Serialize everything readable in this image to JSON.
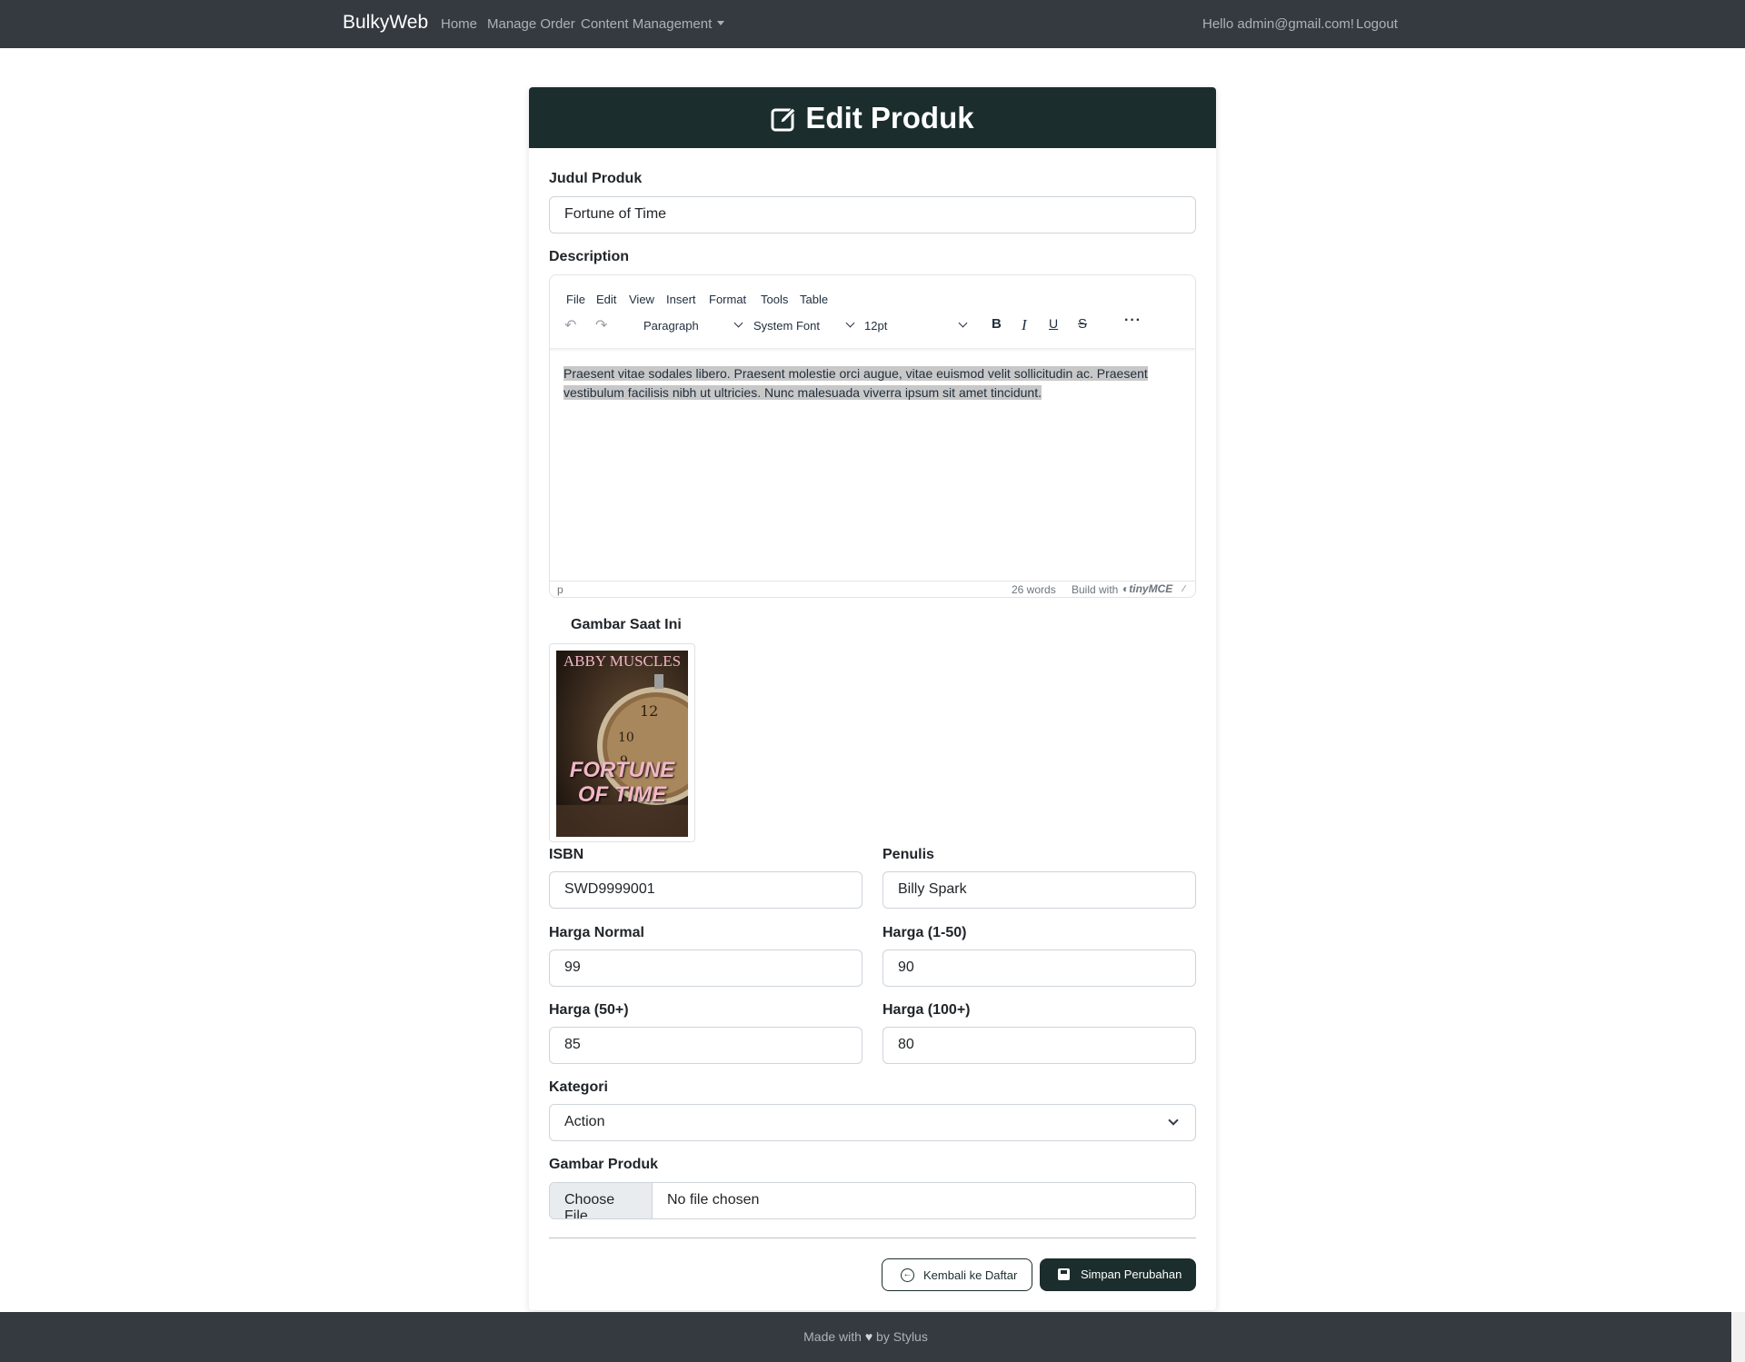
{
  "navbar": {
    "brand": "BulkyWeb",
    "links": [
      "Home",
      "Manage Order",
      "Content Management"
    ],
    "greeting": "Hello admin@gmail.com!",
    "logout": "Logout"
  },
  "card": {
    "title": "Edit Produk"
  },
  "form": {
    "judul_label": "Judul Produk",
    "judul_value": "Fortune of Time",
    "description_label": "Description",
    "gambar_saat_ini_label": "Gambar Saat Ini",
    "isbn_label": "ISBN",
    "isbn_value": "SWD9999001",
    "penulis_label": "Penulis",
    "penulis_value": "Billy Spark",
    "harga_normal_label": "Harga Normal",
    "harga_normal_value": "99",
    "harga_1_50_label": "Harga (1-50)",
    "harga_1_50_value": "90",
    "harga_50_label": "Harga (50+)",
    "harga_50_value": "85",
    "harga_100_label": "Harga (100+)",
    "harga_100_value": "80",
    "kategori_label": "Kategori",
    "kategori_value": "Action",
    "gambar_produk_label": "Gambar Produk",
    "file_button": "Choose File",
    "file_status": "No file chosen"
  },
  "editor": {
    "menu": [
      "File",
      "Edit",
      "View",
      "Insert",
      "Format",
      "Tools",
      "Table"
    ],
    "block_format": "Paragraph",
    "font_family": "System Font",
    "font_size": "12pt",
    "content": "Praesent vitae sodales libero. Praesent molestie orci augue, vitae euismod velit sollicitudin ac. Praesent vestibulum facilisis nibh ut ultricies. Nunc malesuada viverra ipsum sit amet tincidunt.",
    "status_path": "p",
    "word_count": "26 words",
    "build_with": "Build with",
    "brand": "tinyMCE"
  },
  "cover": {
    "author": "ABBY MUSCLES",
    "title_line1": "FORTUNE",
    "title_line2": "OF TIME"
  },
  "actions": {
    "back_label": "Kembali ke Daftar",
    "save_label": "Simpan Perubahan"
  },
  "footer": {
    "prefix": "Made with",
    "suffix": "by Stylus"
  },
  "colors": {
    "navbar": "#343a40",
    "accent": "#1b2d2c"
  }
}
